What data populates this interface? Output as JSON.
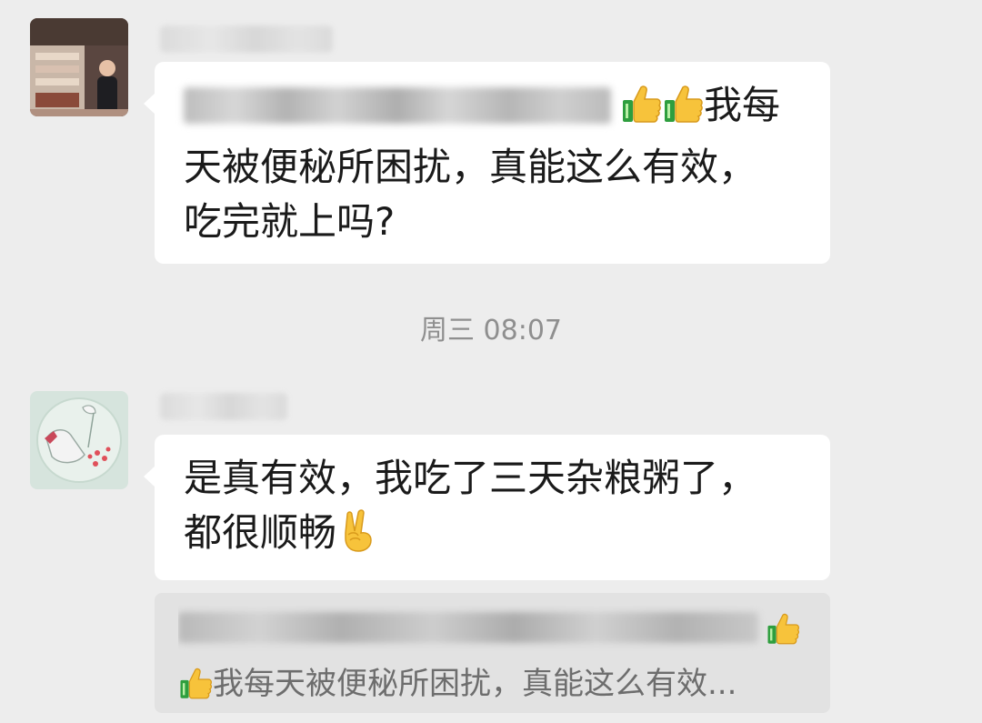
{
  "messages": [
    {
      "text_line1_suffix": "我每",
      "text_line2": "天被便秘所困扰，真能这么有效，",
      "text_line3": "吃完就上吗?"
    },
    {
      "text_line1": "是真有效，我吃了三天杂粮粥了，",
      "text_line2": "都很顺畅"
    }
  ],
  "timestamp": "周三 08:07",
  "quote": {
    "text": "我每天被便秘所困扰，真能这么有效..."
  },
  "icons": {
    "thumbs_up": "thumbs-up-icon",
    "victory_hand": "victory-hand-icon"
  },
  "colors": {
    "background": "#ededed",
    "bubble": "#ffffff",
    "timestamp": "#8f8f8f",
    "quote_background": "#e2e2e2"
  }
}
